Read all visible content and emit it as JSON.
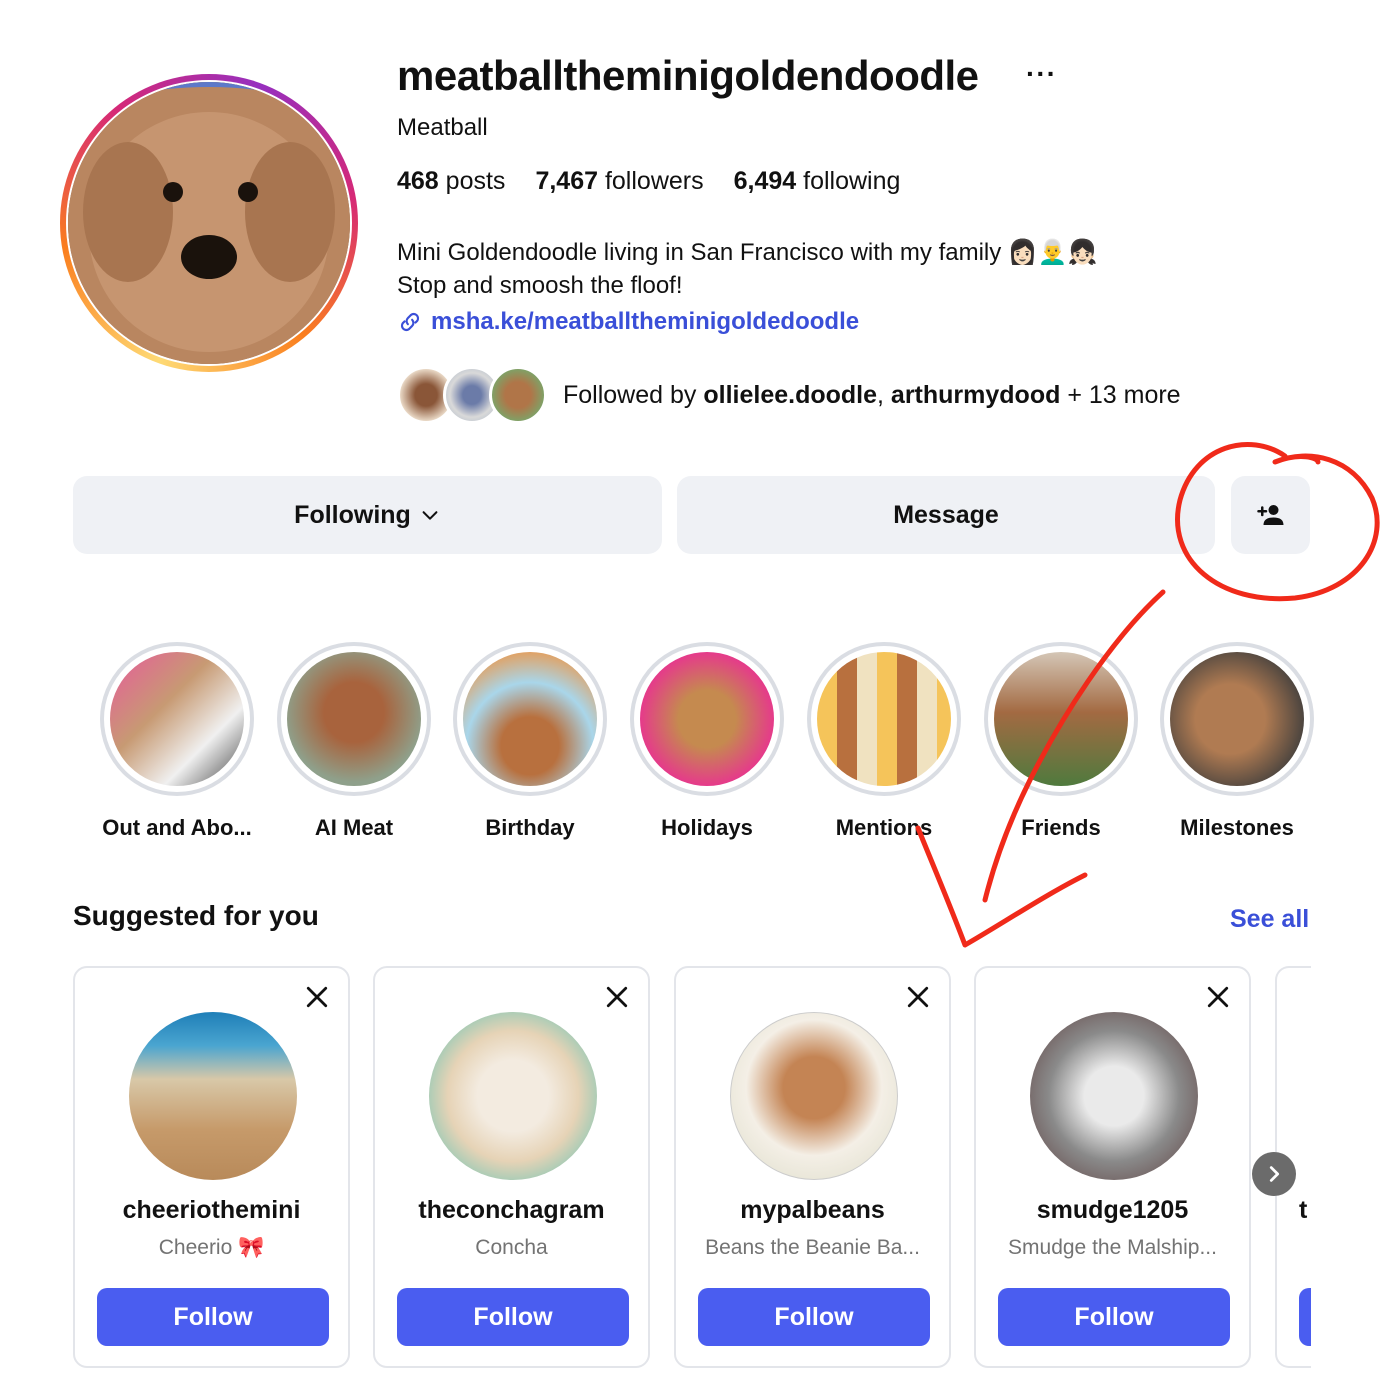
{
  "profile": {
    "username": "meatballtheminigoldendoodle",
    "more_label": "···",
    "display_name": "Meatball",
    "stats": {
      "posts_count": "468",
      "posts_label": "posts",
      "followers_count": "7,467",
      "followers_label": "followers",
      "following_count": "6,494",
      "following_label": "following"
    },
    "bio_line1": "Mini Goldendoodle living in San Francisco with my family 👩🏻👨‍🦳👧🏻",
    "bio_line2": "Stop and smoosh the floof!",
    "link": "msha.ke/meatballtheminigoldedoodle",
    "followed_by_prefix": "Followed by ",
    "followed_by_user1": "ollielee.doodle",
    "followed_by_sep": ", ",
    "followed_by_user2": "arthurmydood",
    "followed_by_suffix": " + 13 more"
  },
  "actions": {
    "following_label": "Following",
    "message_label": "Message"
  },
  "highlights": [
    {
      "label": "Out and Abo..."
    },
    {
      "label": "AI Meat"
    },
    {
      "label": "Birthday"
    },
    {
      "label": "Holidays"
    },
    {
      "label": "Mentions"
    },
    {
      "label": "Friends"
    },
    {
      "label": "Milestones"
    }
  ],
  "suggested": {
    "title": "Suggested for you",
    "see_all": "See all",
    "cards": [
      {
        "username": "cheeriothemini",
        "name": "Cheerio 🎀",
        "follow": "Follow"
      },
      {
        "username": "theconchagram",
        "name": "Concha",
        "follow": "Follow"
      },
      {
        "username": "mypalbeans",
        "name": "Beans the Beanie Ba...",
        "follow": "Follow"
      },
      {
        "username": "smudge1205",
        "name": "Smudge the Malship...",
        "follow": "Follow"
      }
    ],
    "partial_card_username": "t"
  },
  "colors": {
    "accent_blue": "#4a5df0",
    "link_blue": "#3a4fd8",
    "annotation_red": "#f02a1a",
    "button_gray": "#eff1f5"
  },
  "icons": [
    "more-dots-icon",
    "link-icon",
    "chevron-down-icon",
    "add-person-icon",
    "close-icon",
    "chevron-right-icon"
  ]
}
